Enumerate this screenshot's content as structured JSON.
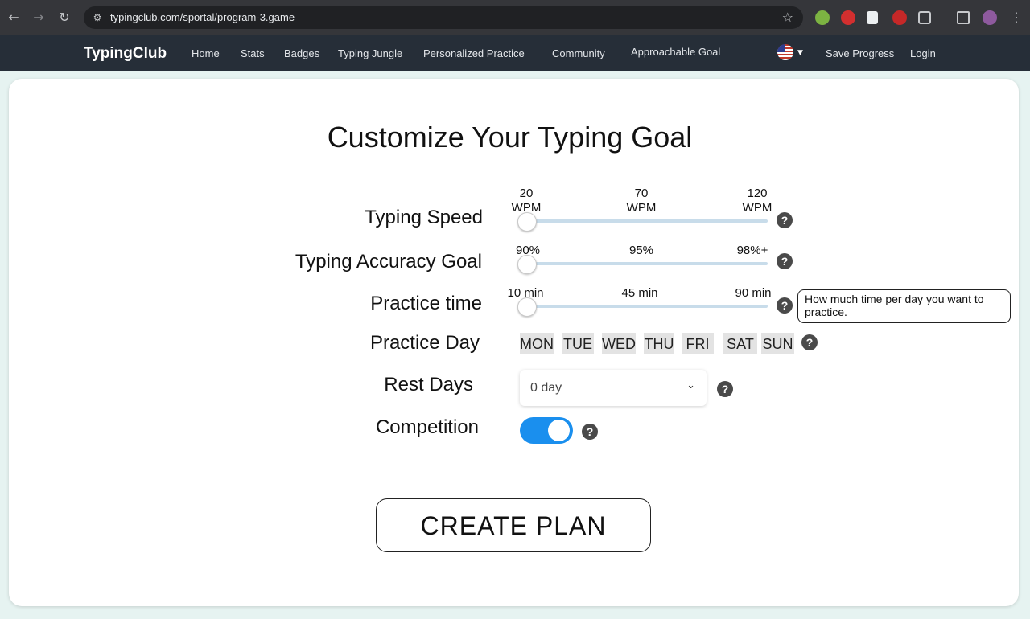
{
  "browser": {
    "url": "typingclub.com/sportal/program-3.game",
    "back_icon": "←",
    "forward_icon": "→",
    "reload_icon": "↻",
    "tune_icon": "⚙",
    "star_icon": "☆",
    "menu_icon": "⋮"
  },
  "site_nav": {
    "logo": "TypingClub",
    "links": [
      "Home",
      "Stats",
      "Badges",
      "Typing Jungle",
      "Personalized Practice",
      "Community",
      "Approachable Goal"
    ],
    "save_progress": "Save Progress",
    "login": "Login",
    "caret": "▼"
  },
  "page": {
    "title": "Customize Your Typing Goal",
    "typing_speed": {
      "label": "Typing Speed",
      "ticks": [
        [
          "20",
          "WPM"
        ],
        [
          "70",
          "WPM"
        ],
        [
          "120",
          "WPM"
        ]
      ],
      "value_fraction": 0
    },
    "accuracy": {
      "label": "Typing Accuracy Goal",
      "ticks": [
        "90%",
        "95%",
        "98%+"
      ],
      "value_fraction": 0
    },
    "practice_time": {
      "label": "Practice time",
      "ticks": [
        "10 min",
        "45 min",
        "90 min"
      ],
      "value_fraction": 0,
      "tooltip": "How much time per day you want to practice."
    },
    "practice_day": {
      "label": "Practice Day",
      "days": [
        "MON",
        "TUE",
        "WED",
        "THU",
        "FRI",
        "SAT",
        "SUN"
      ]
    },
    "rest_days": {
      "label": "Rest Days",
      "value": "0 day",
      "chevron": "⌄"
    },
    "competition": {
      "label": "Competition",
      "enabled": true
    },
    "help_glyph": "?",
    "create_button": "CREATE PLAN",
    "accent_color": "#1a8fee"
  }
}
